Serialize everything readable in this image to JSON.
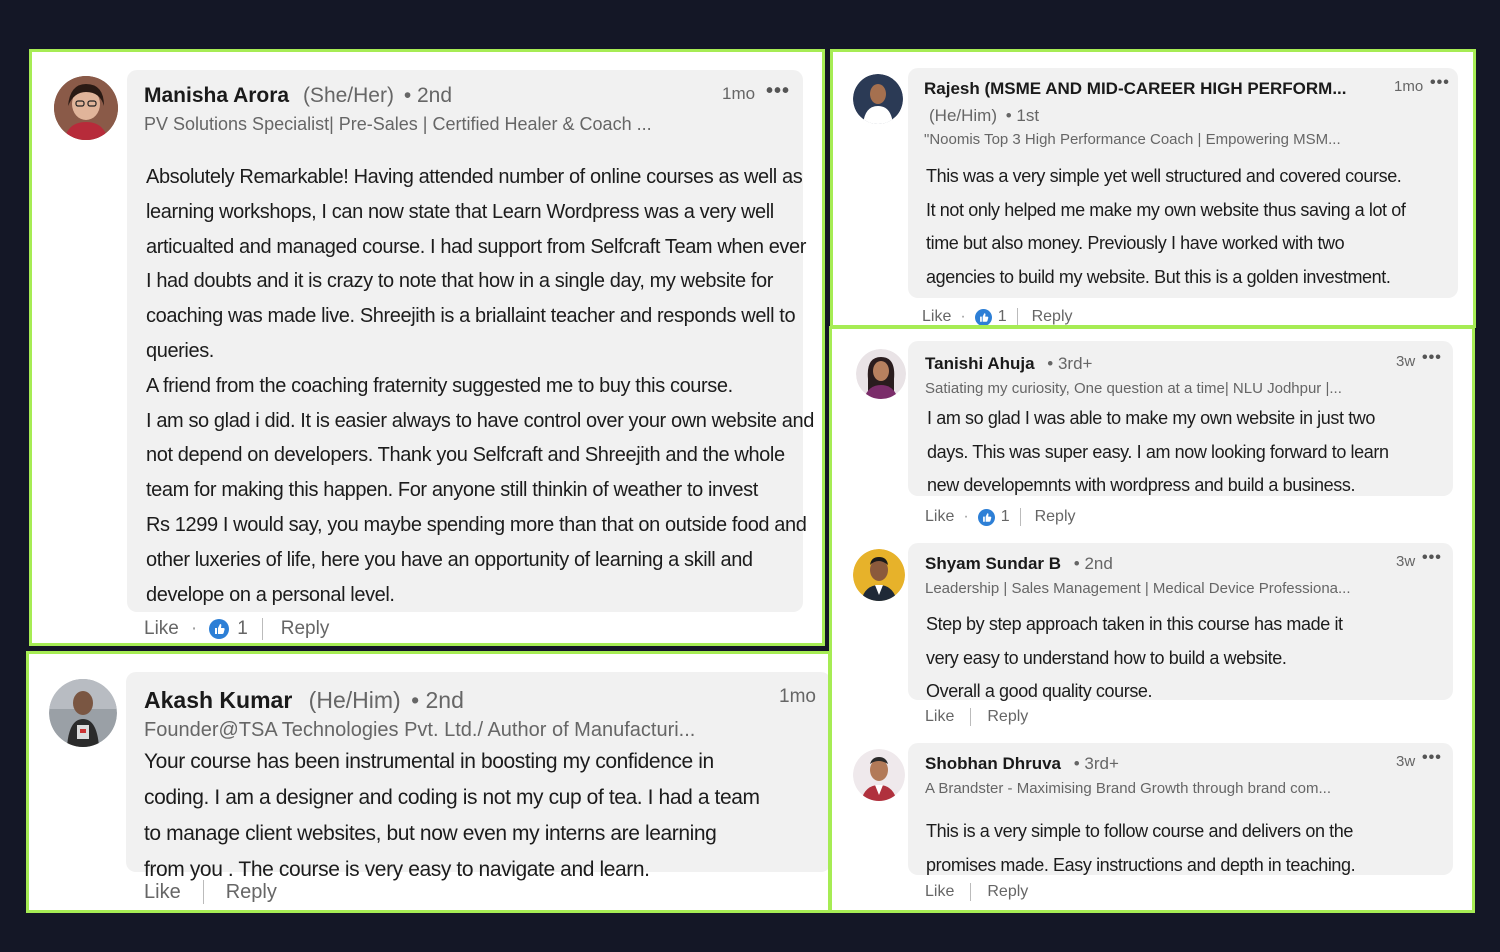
{
  "comments": {
    "manisha": {
      "name": "Manisha Arora",
      "pronouns": "(She/Her)",
      "degree": "• 2nd",
      "headline": "PV Solutions Specialist| Pre-Sales | Certified Healer & Coach ...",
      "time": "1mo",
      "lines": [
        "Absolutely Remarkable! Having attended number of online courses as well as",
        "learning workshops, I can now state that Learn Wordpress was a very well",
        "articualted and managed course. I had support from Selfcraft Team when ever",
        "I had doubts and it is crazy to note that how in a single day, my website for",
        "coaching was made live. Shreejith is a briallaint teacher and responds well to",
        "queries.",
        "A friend from the coaching fraternity suggested me to buy this course.",
        "I am so glad i did. It is easier always to have control over your own website and",
        "not depend on developers. Thank you Selfcraft and Shreejith and the whole",
        "team for making this happen. For anyone still thinkin of weather to invest",
        "Rs 1299 I would say, you maybe spending more than that on outside food and",
        "other luxeries of life, here you have an opportunity of learning a skill and",
        "develope on a personal level."
      ],
      "like": "Like",
      "dot": "·",
      "count": "1",
      "reply": "Reply"
    },
    "akash": {
      "name": "Akash Kumar",
      "pronouns": "(He/Him)",
      "degree": "• 2nd",
      "headline": "Founder@TSA Technologies Pvt. Ltd./ Author of Manufacturi...",
      "time": "1mo",
      "lines": [
        "Your course has been instrumental in boosting my confidence in",
        "coding. I am a designer and coding is not my cup of tea. I had a team",
        "to manage client websites, but now even my interns are learning",
        "from you . The course is very easy to navigate and learn."
      ],
      "like": "Like",
      "reply": "Reply"
    },
    "rajesh": {
      "name": "Rajesh (MSME AND MID-CAREER HIGH PERFORM...",
      "pronouns": "(He/Him)",
      "degree": "• 1st",
      "headline": "\"Noomis Top 3 High Performance Coach | Empowering MSM...",
      "time": "1mo",
      "lines": [
        "This was a very simple yet well structured and covered course.",
        "It not only helped me make my own website thus saving a lot of",
        "time but also money. Previously I have worked with two",
        "agencies to build my website. But this is a golden investment."
      ],
      "like": "Like",
      "dot": "·",
      "count": "1",
      "reply": "Reply"
    },
    "tanishi": {
      "name": "Tanishi Ahuja",
      "degree": "• 3rd+",
      "headline": "Satiating my curiosity, One question at a time| NLU Jodhpur |...",
      "time": "3w",
      "lines": [
        "I am so glad I was able to make my own website in just two",
        "days. This was super easy. I am now looking forward to learn",
        "new developemnts with wordpress and build a business."
      ],
      "like": "Like",
      "dot": "·",
      "count": "1",
      "reply": "Reply"
    },
    "shyam": {
      "name": "Shyam Sundar B",
      "degree": "• 2nd",
      "headline": "Leadership | Sales Management | Medical Device Professiona...",
      "time": "3w",
      "lines": [
        "Step by step approach taken in this course has made it",
        "very easy to understand how to build a website.",
        "Overall a good quality course."
      ],
      "like": "Like",
      "reply": "Reply"
    },
    "shobhan": {
      "name": "Shobhan Dhruva",
      "degree": "• 3rd+",
      "headline": "A Brandster - Maximising Brand Growth through brand com...",
      "time": "3w",
      "lines": [
        "This is a very simple to follow course and delivers on the",
        "promises made. Easy instructions and depth in teaching."
      ],
      "like": "Like",
      "reply": "Reply"
    }
  },
  "colors": {
    "border": "#a6ec54",
    "background": "#141726",
    "like_blue": "#2d7fd6"
  },
  "icons": [
    "more-icon",
    "like-reaction-icon",
    "avatar"
  ]
}
